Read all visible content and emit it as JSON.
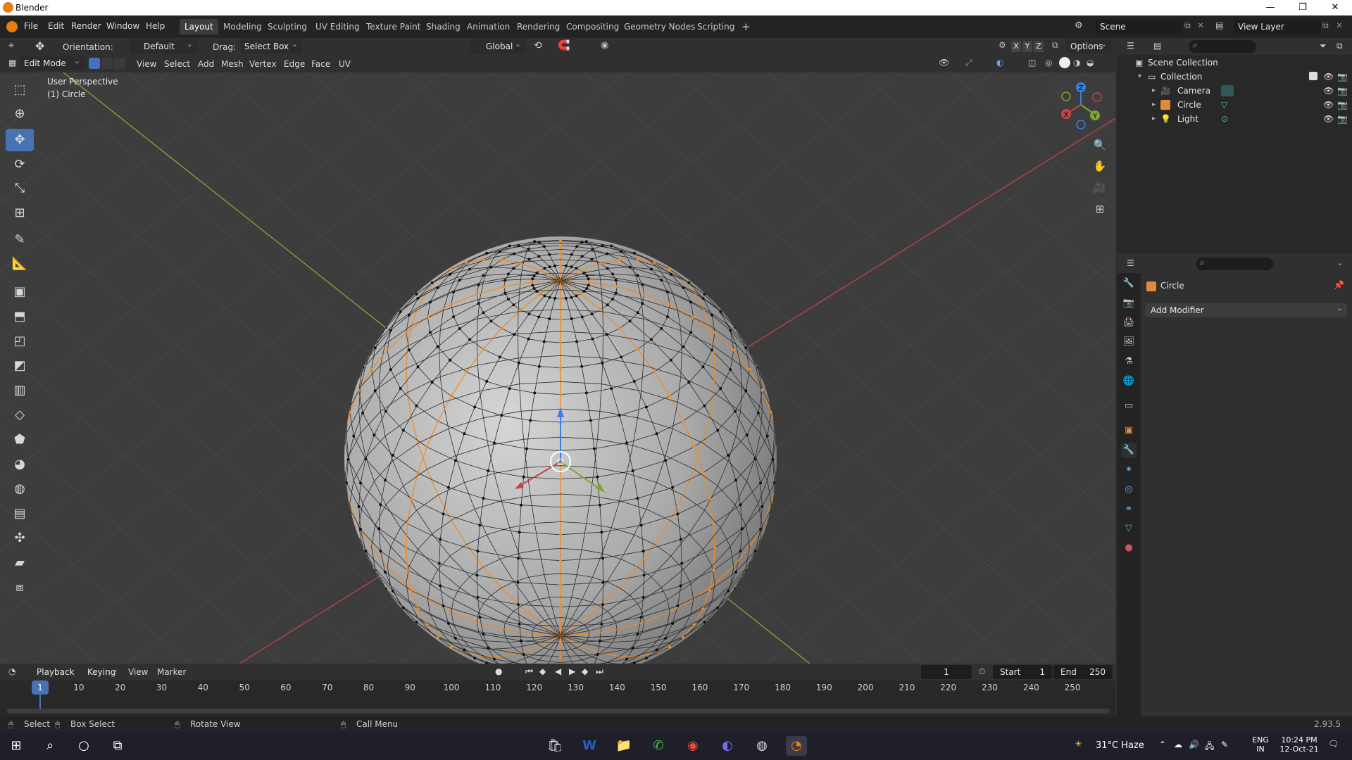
{
  "window": {
    "title": "Blender",
    "minimize": "—",
    "restore": "❐",
    "close": "✕"
  },
  "menu": [
    "File",
    "Edit",
    "Render",
    "Window",
    "Help"
  ],
  "workspaces": [
    "Layout",
    "Modeling",
    "Sculpting",
    "UV Editing",
    "Texture Paint",
    "Shading",
    "Animation",
    "Rendering",
    "Compositing",
    "Geometry Nodes",
    "Scripting"
  ],
  "active_workspace": "Layout",
  "scene": {
    "name": "Scene",
    "view_layer": "View Layer"
  },
  "header1": {
    "orientation_label": "Orientation:",
    "orientation_value": "Default",
    "drag_label": "Drag:",
    "drag_value": "Select Box",
    "transform_value": "Global",
    "axes": [
      "X",
      "Y",
      "Z"
    ],
    "options_label": "Options"
  },
  "header2": {
    "mode": "Edit Mode",
    "menus": [
      "View",
      "Select",
      "Add",
      "Mesh",
      "Vertex",
      "Edge",
      "Face",
      "UV"
    ]
  },
  "viewport": {
    "perspective_label": "User Perspective",
    "object_label": "(1) Circle",
    "gizmo_axes": {
      "x": "X",
      "y": "Y",
      "z": "Z"
    },
    "colors": {
      "x_axis": "#c8424a",
      "y_axis": "#7fa336",
      "z_axis": "#3a7ee0",
      "selection": "#f08a23"
    }
  },
  "outliner": {
    "root": "Scene Collection",
    "collection": "Collection",
    "items": [
      {
        "name": "Camera",
        "icon": "camera-icon"
      },
      {
        "name": "Circle",
        "icon": "mesh-icon"
      },
      {
        "name": "Light",
        "icon": "light-icon"
      }
    ]
  },
  "properties": {
    "object_name": "Circle",
    "add_modifier": "Add Modifier"
  },
  "timeline": {
    "menus": [
      "Playback",
      "Keying",
      "View",
      "Marker"
    ],
    "current_frame": "1",
    "start_label": "Start",
    "start_value": "1",
    "end_label": "End",
    "end_value": "250",
    "ticks": [
      "1",
      "10",
      "20",
      "30",
      "40",
      "50",
      "60",
      "70",
      "80",
      "90",
      "100",
      "110",
      "120",
      "130",
      "140",
      "150",
      "160",
      "170",
      "180",
      "190",
      "200",
      "210",
      "220",
      "230",
      "240",
      "250"
    ]
  },
  "statusbar": {
    "select": "Select",
    "box_select": "Box Select",
    "rotate_view": "Rotate View",
    "call_menu": "Call Menu",
    "version": "2.93.5"
  },
  "taskbar": {
    "weather": "31°C  Haze",
    "lang_top": "ENG",
    "lang_bottom": "IN",
    "time": "10:24 PM",
    "date": "12-Oct-21"
  }
}
